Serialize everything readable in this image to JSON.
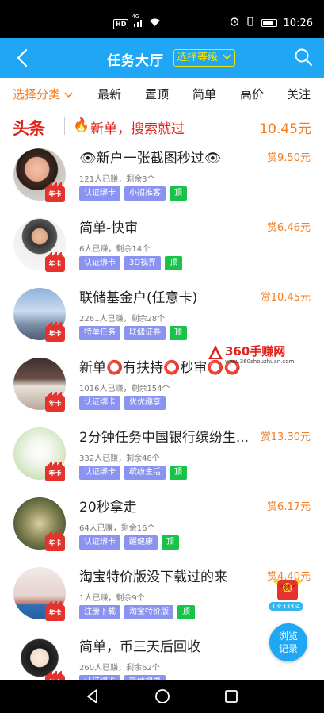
{
  "status_bar": {
    "time": "10:26",
    "hd_label": "HD",
    "signal_label": "4G",
    "icons": [
      "hd-icon",
      "signal-icon",
      "wifi-icon",
      "alarm-icon",
      "vibrate-icon",
      "battery-icon"
    ]
  },
  "header": {
    "title": "任务大厅",
    "level_select": "选择等级",
    "icons": [
      "back-icon",
      "chevron-down-icon",
      "search-icon"
    ]
  },
  "filters": [
    {
      "label": "选择分类",
      "active": true
    },
    {
      "label": "最新"
    },
    {
      "label": "置顶"
    },
    {
      "label": "简单"
    },
    {
      "label": "高价"
    },
    {
      "label": "关注"
    }
  ],
  "headline": {
    "tag": "头条",
    "text": "新单，搜索就过",
    "price": "10.45元",
    "icon": "fire-icon"
  },
  "badge_label": "年卡",
  "tasks": [
    {
      "title": "👁新户一张截图秒过👁",
      "price": "赏9.50元",
      "meta": "121人已赚，剩余3个",
      "tags": [
        "认证绑卡",
        "小招推客",
        "顶"
      ]
    },
    {
      "title": "简单-快审",
      "price": "赏6.46元",
      "meta": "6人已赚，剩余14个",
      "tags": [
        "认证绑卡",
        "3D视界",
        "顶"
      ]
    },
    {
      "title": "联储基金户(任意卡)",
      "price": "赏10.45元",
      "meta": "2261人已赚，剩余28个",
      "tags": [
        "特单任务",
        "联储证券",
        "顶"
      ]
    },
    {
      "title": "新单⭕有扶持⭕秒审⭕⭕",
      "price": "",
      "meta": "1016人已赚，剩余154个",
      "tags": [
        "认证绑卡",
        "优优趣享"
      ]
    },
    {
      "title": "2分钟任务中国银行缤纷生...",
      "price": "赏13.30元",
      "meta": "332人已赚，剩余48个",
      "tags": [
        "认证绑卡",
        "缤纷生活",
        "顶"
      ]
    },
    {
      "title": "20秒拿走",
      "price": "赏6.17元",
      "meta": "64人已赚，剩余16个",
      "tags": [
        "认证绑卡",
        "醒健康",
        "顶"
      ]
    },
    {
      "title": "淘宝特价版没下载过的来",
      "price": "赏4.40元",
      "meta": "1人已赚，剩余9个",
      "tags": [
        "注册下载",
        "淘宝特价版",
        "顶"
      ]
    },
    {
      "title": "简单，币三天后回收",
      "price": "",
      "meta": "260人已赚，剩余62个",
      "tags": [
        "认证绑卡",
        "新纳视界"
      ]
    }
  ],
  "watermark": {
    "name": "360手赚网",
    "url": "www.360shouzhuan.com"
  },
  "floating": {
    "timer": "13:33:04",
    "browse_line1": "浏览",
    "browse_line2": "记录",
    "redpack_label": "领"
  },
  "colors": {
    "primary": "#1fa6f5",
    "accent_orange": "#f57c1f",
    "red": "#e2231a",
    "tag_purple": "#8b93f0",
    "tag_green": "#19c34a",
    "level_yellow": "#f7e400"
  }
}
